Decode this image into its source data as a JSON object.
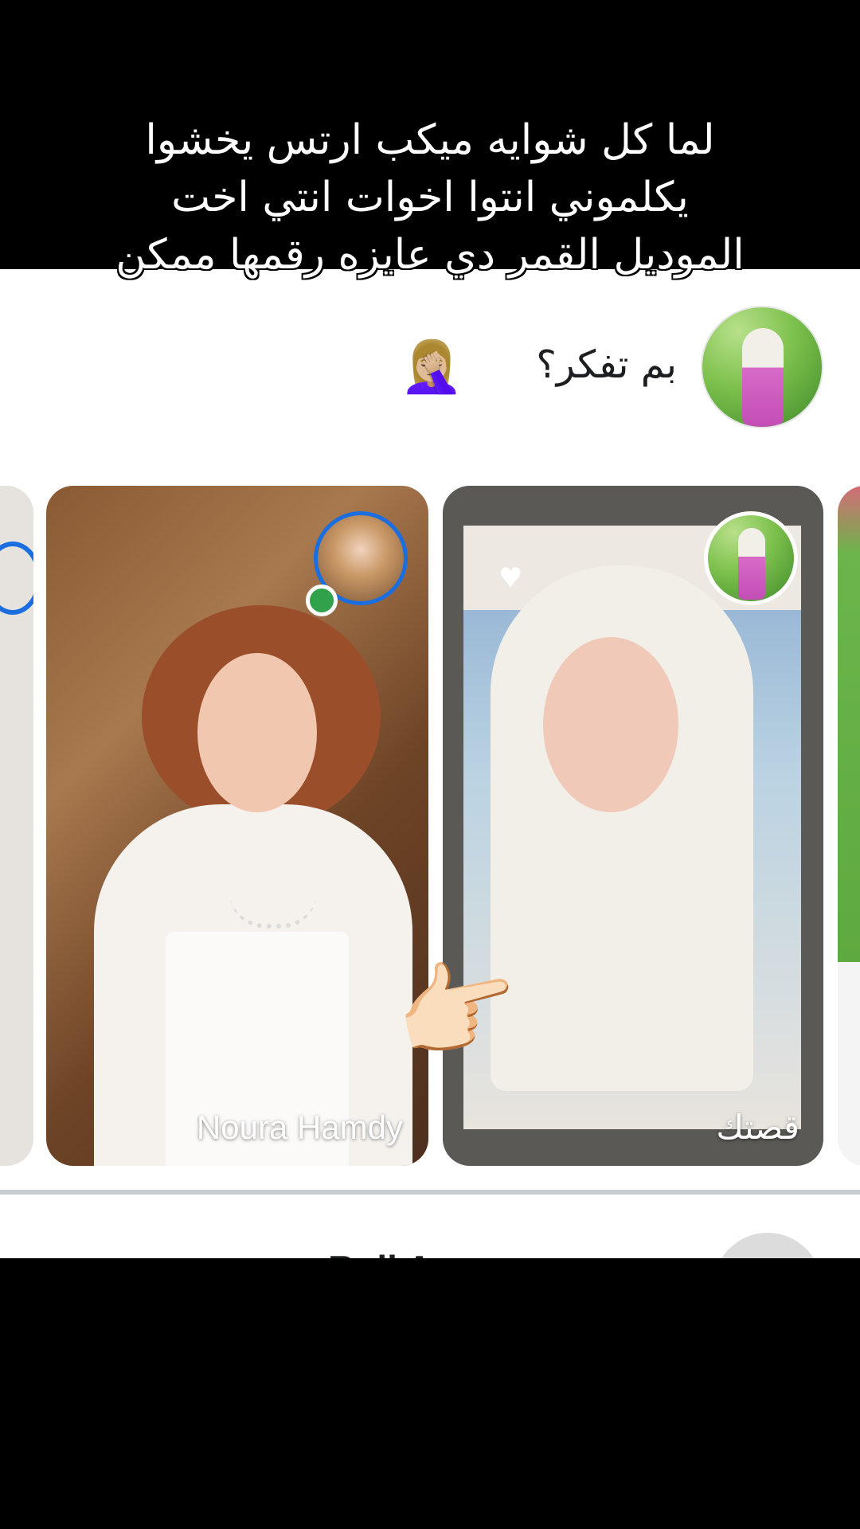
{
  "caption": {
    "line1": "لما كل شوايه ميكب ارتس يخشوا",
    "line2": "يكلموني  انتوا اخوات انتي اخت",
    "line3": "الموديل القمر دي عايزه رقمها ممكن"
  },
  "composer": {
    "placeholder": "بم تفكر؟",
    "emoji": "🤦🏼‍♀️"
  },
  "stories": [
    {
      "label": "Noura Hamdy",
      "online": true
    },
    {
      "label": "قصتك"
    }
  ],
  "stickers": {
    "pointer": "👉🏻"
  },
  "next_post": {
    "title": "R  di    A"
  },
  "colors": {
    "story_ring": "#1a6ee0",
    "online": "#31a24c",
    "divider": "#c8cbd0"
  }
}
